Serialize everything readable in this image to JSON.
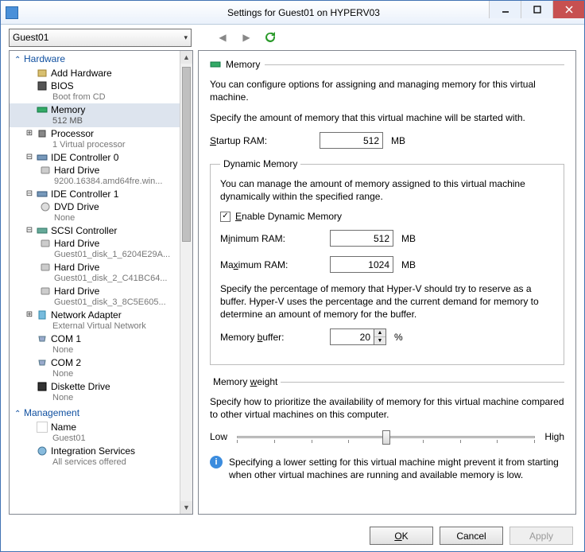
{
  "window": {
    "title": "Settings for Guest01 on HYPERV03"
  },
  "combo": {
    "value": "Guest01"
  },
  "sections": {
    "hardware": "Hardware",
    "management": "Management"
  },
  "tree": {
    "add_hardware": "Add Hardware",
    "bios": {
      "label": "BIOS",
      "sub": "Boot from CD"
    },
    "memory": {
      "label": "Memory",
      "sub": "512 MB"
    },
    "processor": {
      "label": "Processor",
      "sub": "1 Virtual processor"
    },
    "ide0": {
      "label": "IDE Controller 0"
    },
    "ide0_hd": {
      "label": "Hard Drive",
      "sub": "9200.16384.amd64fre.win..."
    },
    "ide1": {
      "label": "IDE Controller 1"
    },
    "ide1_dvd": {
      "label": "DVD Drive",
      "sub": "None"
    },
    "scsi": {
      "label": "SCSI Controller"
    },
    "scsi_hd1": {
      "label": "Hard Drive",
      "sub": "Guest01_disk_1_6204E29A..."
    },
    "scsi_hd2": {
      "label": "Hard Drive",
      "sub": "Guest01_disk_2_C41BC64..."
    },
    "scsi_hd3": {
      "label": "Hard Drive",
      "sub": "Guest01_disk_3_8C5E605..."
    },
    "nic": {
      "label": "Network Adapter",
      "sub": "External Virtual Network"
    },
    "com1": {
      "label": "COM 1",
      "sub": "None"
    },
    "com2": {
      "label": "COM 2",
      "sub": "None"
    },
    "floppy": {
      "label": "Diskette Drive",
      "sub": "None"
    },
    "name": {
      "label": "Name",
      "sub": "Guest01"
    },
    "integration": {
      "label": "Integration Services",
      "sub": "All services offered"
    }
  },
  "main": {
    "header": "Memory",
    "intro": "You can configure options for assigning and managing memory for this virtual machine.",
    "startup_line": "Specify the amount of memory that this virtual machine will be started with.",
    "startup_label_pre": "S",
    "startup_label_post": "tartup RAM:",
    "startup_value": "512",
    "mb": "MB",
    "dyn_group": "Dynamic Memory",
    "dyn_intro": "You can manage the amount of memory assigned to this virtual machine dynamically within the specified range.",
    "enable_label_pre": "E",
    "enable_label_post": "nable Dynamic Memory",
    "min_label_pre": "M",
    "min_label_u": "i",
    "min_label_post": "nimum RAM:",
    "min_value": "512",
    "max_label_pre": "Ma",
    "max_label_u": "x",
    "max_label_post": "imum RAM:",
    "max_value": "1024",
    "buffer_intro": "Specify the percentage of memory that Hyper-V should try to reserve as a buffer. Hyper-V uses the percentage and the current demand for memory to determine an amount of memory for the buffer.",
    "buffer_label_pre": "Memory ",
    "buffer_label_u": "b",
    "buffer_label_post": "uffer:",
    "buffer_value": "20",
    "pct": "%",
    "weight_group_pre": "Memory ",
    "weight_group_u": "w",
    "weight_group_post": "eight",
    "weight_intro": "Specify how to prioritize the availability of memory for this virtual machine compared to other virtual machines on this computer.",
    "low": "Low",
    "high": "High",
    "info": "Specifying a lower setting for this virtual machine might prevent it from starting when other virtual machines are running and available memory is low."
  },
  "footer": {
    "ok_pre": "O",
    "ok_u": "K",
    "cancel_pre": "C",
    "cancel_u": "",
    "cancel": "Cancel",
    "apply_pre": "A",
    "apply_u": "",
    "apply": "Apply"
  }
}
